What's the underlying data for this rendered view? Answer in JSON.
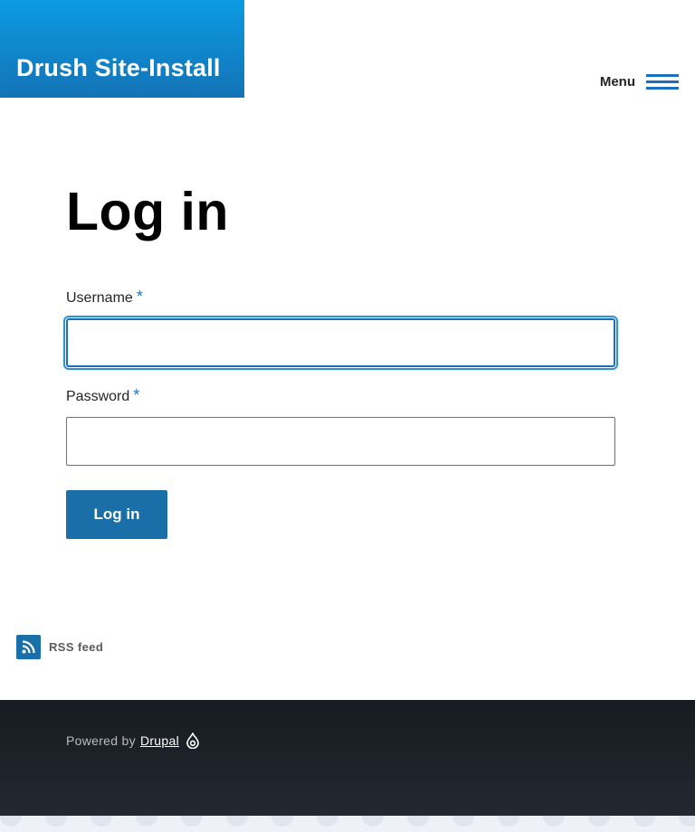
{
  "header": {
    "site_name": "Drush Site-Install",
    "menu_label": "Menu"
  },
  "main": {
    "title": "Log in",
    "username": {
      "label": "Username",
      "required_mark": "*",
      "value": "",
      "placeholder": ""
    },
    "password": {
      "label": "Password",
      "required_mark": "*",
      "value": "",
      "placeholder": ""
    },
    "submit_label": "Log in"
  },
  "feed": {
    "label": "RSS feed",
    "icon": "rss-icon"
  },
  "footer": {
    "powered_by": "Powered by",
    "drupal_link": "Drupal",
    "icon": "drupal-drop-icon"
  },
  "colors": {
    "brand_blue": "#1b6fa9",
    "header_gradient_top": "#0b9be2",
    "header_gradient_bottom": "#1473b7",
    "footer_bg": "#171c22",
    "focus_ring": "#2494db"
  }
}
